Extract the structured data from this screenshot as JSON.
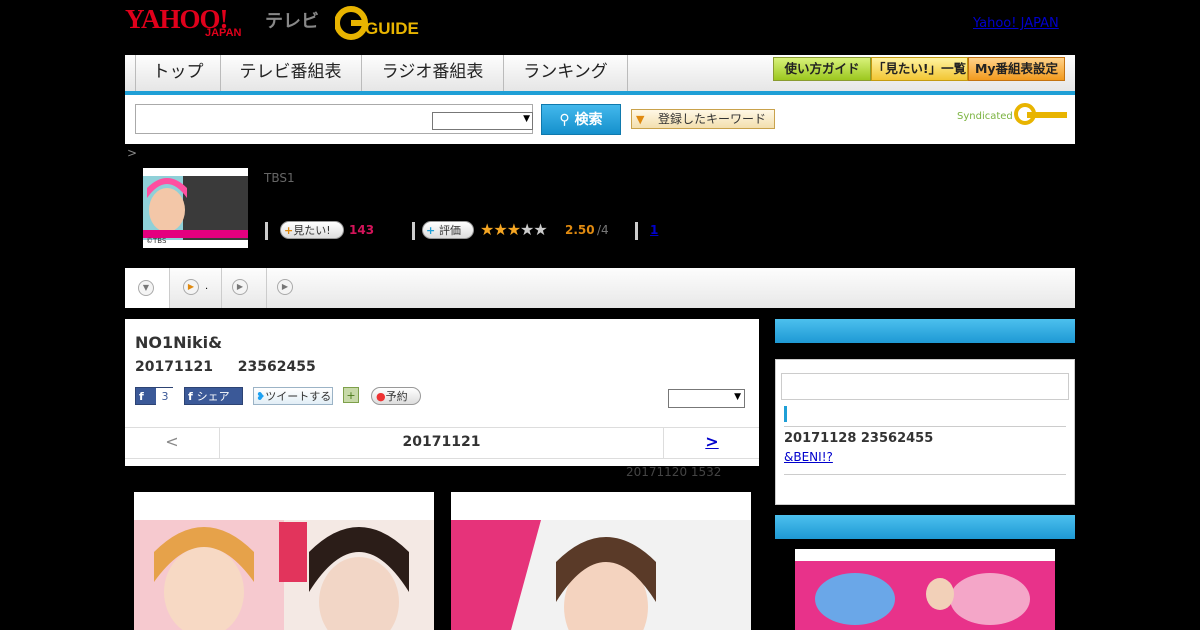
{
  "header": {
    "yahoo_logo": "YAHOO!",
    "japan_logo": "JAPAN",
    "tv_label": "テレビ",
    "gguide_logo": "GUIDE",
    "yahoo_japan_link": "Yahoo! JAPAN"
  },
  "nav": {
    "tabs": [
      "トップ",
      "テレビ番組表",
      "ラジオ番組表",
      "ランキング"
    ],
    "guide_buttons": [
      "使い方ガイド",
      "「見たい!」一覧",
      "My番組表設定"
    ]
  },
  "search": {
    "value": "",
    "search_button": "検索",
    "keyword_button": "登録したキーワード",
    "syndicated": "Syndicated"
  },
  "program": {
    "breadcrumb": ">",
    "thumb_credit": "©TBS",
    "channel": "TBS1",
    "want_label": "見たい!",
    "want_count": "143",
    "rate_label": "評価",
    "rating": "2.50",
    "rating_max": "/4",
    "review_count": "1"
  },
  "main": {
    "title": "NO1Niki&",
    "date_time": "20171121 23562455",
    "fb_count": "3",
    "share_label": "シェア",
    "tweet_label": "ツイートする",
    "reserve_label": "予約",
    "prev": "<",
    "current_date": "20171121",
    "next": ">",
    "updated": "20171120  1532"
  },
  "side": {
    "next_date": "20171128  23562455",
    "next_title": "&BENI!?"
  },
  "colors": {
    "accent": "#1f9fd6",
    "yahoo_red": "#e0001b",
    "want_pink": "#d4145a",
    "star_orange": "#f5a623"
  }
}
